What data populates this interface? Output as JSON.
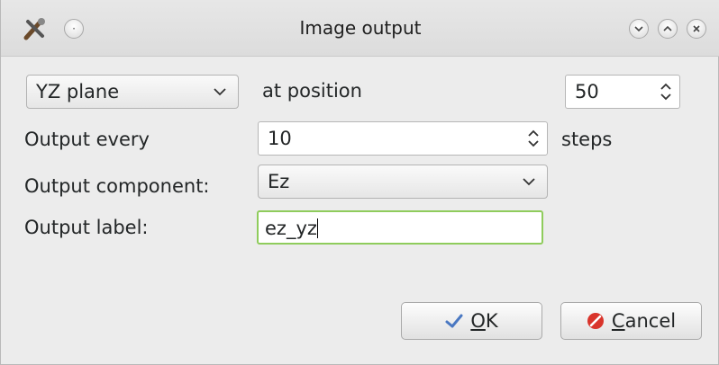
{
  "window": {
    "title": "Image output"
  },
  "plane_select": {
    "value": "YZ plane"
  },
  "labels": {
    "at_position": "at position",
    "output_every": "Output every",
    "steps": "steps",
    "output_component": "Output component:",
    "output_label": "Output label:"
  },
  "position_spin": {
    "value": "50"
  },
  "every_spin": {
    "value": "10"
  },
  "component_select": {
    "value": "Ez"
  },
  "label_field": {
    "value": "ez_yz"
  },
  "buttons": {
    "ok_mnemonic": "O",
    "ok_rest": "K",
    "cancel_mnemonic": "C",
    "cancel_rest": "ancel"
  },
  "icons": {
    "app": "tools-icon",
    "pin": "pin-icon",
    "minimize": "chevron-down-icon",
    "maximize": "chevron-up-icon",
    "close": "close-icon",
    "ok": "check-icon",
    "cancel": "cancel-icon"
  },
  "colors": {
    "focus_border": "#8fcc5c",
    "cancel_icon": "#d9342b",
    "ok_icon": "#4a78c2"
  }
}
